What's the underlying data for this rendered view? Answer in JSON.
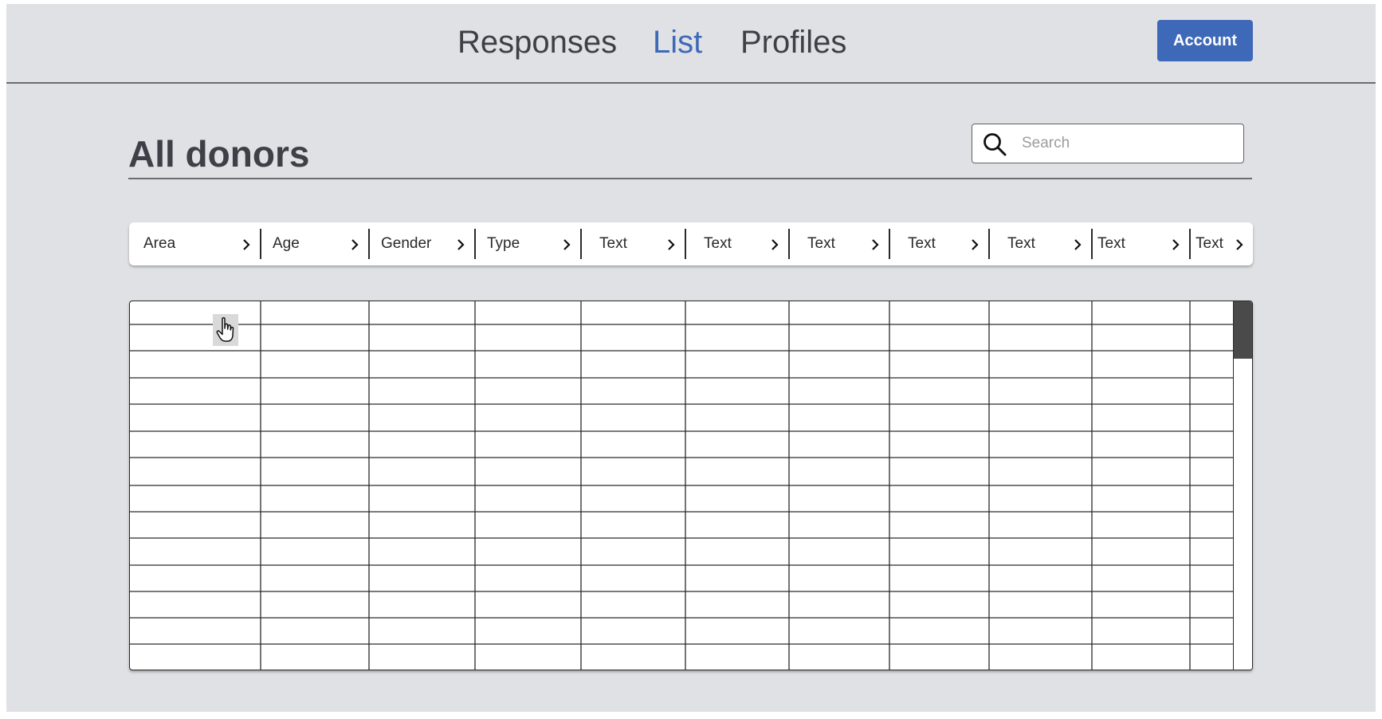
{
  "nav": {
    "tabs": [
      {
        "label": "Responses",
        "active": false
      },
      {
        "label": "List",
        "active": true
      },
      {
        "label": "Profiles",
        "active": false
      }
    ],
    "account_label": "Account"
  },
  "colors": {
    "accent": "#3e69b8",
    "background": "#e0e1e5",
    "text": "#3d4147"
  },
  "page": {
    "title": "All donors"
  },
  "search": {
    "placeholder": "Search",
    "value": "",
    "icon": "search-icon"
  },
  "table": {
    "columns": [
      {
        "label": "Area"
      },
      {
        "label": "Age"
      },
      {
        "label": "Gender"
      },
      {
        "label": "Type"
      },
      {
        "label": "Text"
      },
      {
        "label": "Text"
      },
      {
        "label": "Text"
      },
      {
        "label": "Text"
      },
      {
        "label": "Text"
      },
      {
        "label": "Text"
      },
      {
        "label": "Text"
      }
    ],
    "column_sort_icon": "chevron-right-icon",
    "row_count": 14,
    "rows_empty": true,
    "cursor_icon": "hand-pointer-icon"
  }
}
